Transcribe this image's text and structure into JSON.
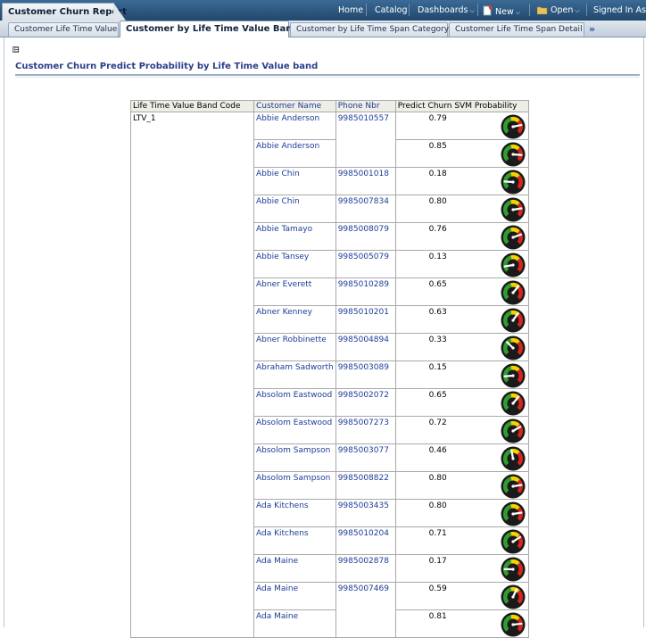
{
  "header": {
    "app_title": "Customer Churn Report",
    "nav": {
      "home": "Home",
      "catalog": "Catalog",
      "dashboards": "Dashboards",
      "new": "New",
      "open": "Open",
      "signed_in": "Signed In As"
    }
  },
  "tabs": [
    {
      "label": "Customer Life Time Value",
      "active": false
    },
    {
      "label": "Customer by Life Time Value Band",
      "active": true
    },
    {
      "label": "Customer by Life Time Span Category",
      "active": false
    },
    {
      "label": "Customer Life Time Span Detail",
      "active": false
    }
  ],
  "tabs_more": "»",
  "section": {
    "collapse_symbol": "⊟",
    "title": "Customer Churn Predict Probability by Life Time Value band"
  },
  "table": {
    "headers": [
      "Life Time Value Band Code",
      "Customer Name",
      "Phone Nbr",
      "Predict Churn SVM Probability"
    ],
    "band_code": "LTV_1",
    "rows": [
      {
        "name": "Abbie Anderson",
        "phone": "9985010557",
        "prob": "0.79"
      },
      {
        "name": "Abbie Anderson",
        "phone": "",
        "prob": "0.85"
      },
      {
        "name": "Abbie Chin",
        "phone": "9985001018",
        "prob": "0.18"
      },
      {
        "name": "Abbie Chin",
        "phone": "9985007834",
        "prob": "0.80"
      },
      {
        "name": "Abbie Tamayo",
        "phone": "9985008079",
        "prob": "0.76"
      },
      {
        "name": "Abbie Tansey",
        "phone": "9985005079",
        "prob": "0.13"
      },
      {
        "name": "Abner Everett",
        "phone": "9985010289",
        "prob": "0.65"
      },
      {
        "name": "Abner Kenney",
        "phone": "9985010201",
        "prob": "0.63"
      },
      {
        "name": "Abner Robbinette",
        "phone": "9985004894",
        "prob": "0.33"
      },
      {
        "name": "Abraham Sadworth",
        "phone": "9985003089",
        "prob": "0.15"
      },
      {
        "name": "Absolom Eastwood",
        "phone": "9985002072",
        "prob": "0.65"
      },
      {
        "name": "Absolom Eastwood",
        "phone": "9985007273",
        "prob": "0.72"
      },
      {
        "name": "Absolom Sampson",
        "phone": "9985003077",
        "prob": "0.46"
      },
      {
        "name": "Absolom Sampson",
        "phone": "9985008822",
        "prob": "0.80"
      },
      {
        "name": "Ada Kitchens",
        "phone": "9985003435",
        "prob": "0.80"
      },
      {
        "name": "Ada Kitchens",
        "phone": "9985010204",
        "prob": "0.71"
      },
      {
        "name": "Ada Maine",
        "phone": "9985002878",
        "prob": "0.17"
      },
      {
        "name": "Ada Maine",
        "phone": "9985007469",
        "prob": "0.59"
      },
      {
        "name": "Ada Maine",
        "phone": "",
        "prob": "0.81"
      }
    ]
  },
  "colors": {
    "header_bg": "#2c5580",
    "link": "#1c3d99",
    "section_title": "#2b3e8c",
    "gauge_red": "#d8261d",
    "gauge_yellow": "#f2d400",
    "gauge_green": "#2f9e2f"
  },
  "icons": {
    "gauge": "gauge-icon",
    "new": "new-document-icon",
    "open": "folder-icon",
    "more_tabs": "double-chevron-right-icon"
  }
}
